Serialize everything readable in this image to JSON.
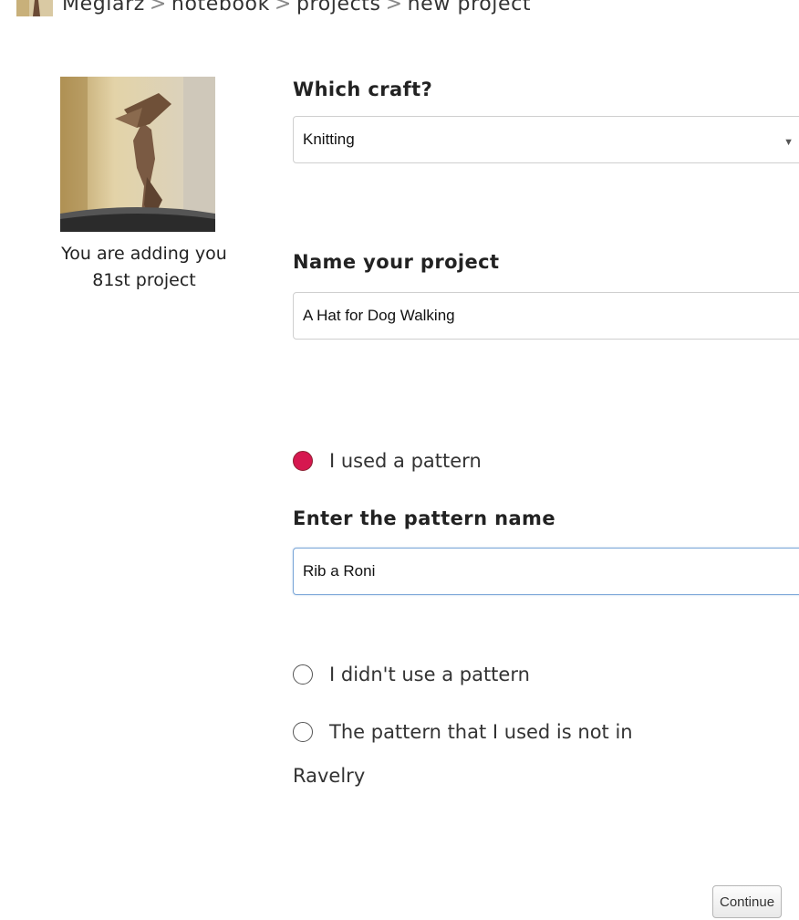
{
  "breadcrumb": {
    "items": [
      "Megiarz",
      "notebook",
      "projects",
      "new project"
    ],
    "separator": ">"
  },
  "sidebar": {
    "adding_line1": "You are adding you",
    "adding_line2": "81st project"
  },
  "form": {
    "craft": {
      "label": "Which craft?",
      "value": "Knitting"
    },
    "name": {
      "label": "Name your project",
      "value": "A Hat for Dog Walking"
    },
    "pattern_options": [
      {
        "label": "I used a pattern",
        "checked": true
      },
      {
        "label": "I didn't use a pattern",
        "checked": false
      },
      {
        "label": "The pattern that I used is not in",
        "label_cont": "Ravelry",
        "checked": false
      }
    ],
    "pattern_name": {
      "label": "Enter the pattern name",
      "value": "Rib a Roni"
    },
    "continue_label": "Continue"
  },
  "colors": {
    "radio_checked": "#d6174f",
    "focus_border": "#7aa6d8"
  }
}
